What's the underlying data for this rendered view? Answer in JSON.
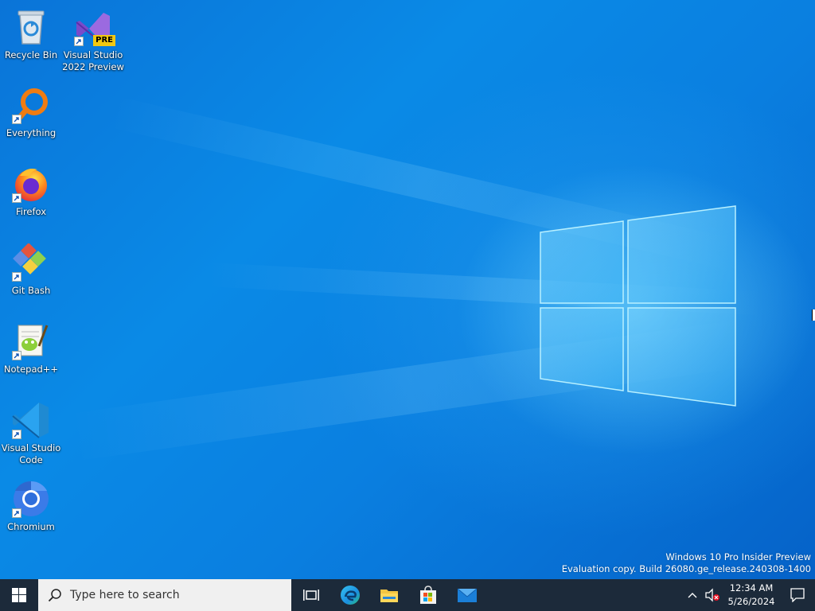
{
  "desktop": {
    "icons": [
      {
        "label": "Recycle Bin",
        "icon": "recycle-bin-icon"
      },
      {
        "label": "Visual Studio 2022 Preview",
        "icon": "visual-studio-preview-icon",
        "badge": "PRE"
      },
      {
        "label": "Everything",
        "icon": "everything-search-icon"
      },
      {
        "label": "Firefox",
        "icon": "firefox-icon"
      },
      {
        "label": "Git Bash",
        "icon": "git-bash-icon"
      },
      {
        "label": "Notepad++",
        "icon": "notepad-plus-plus-icon"
      },
      {
        "label": "Visual Studio Code",
        "icon": "vscode-icon"
      },
      {
        "label": "Chromium",
        "icon": "chromium-icon"
      }
    ],
    "watermark": {
      "line1": "Windows 10 Pro Insider Preview",
      "line2": "Evaluation copy. Build 26080.ge_release.240308-1400"
    }
  },
  "taskbar": {
    "search_placeholder": "Type here to search",
    "pinned": [
      "task-view-icon",
      "edge-icon",
      "file-explorer-icon",
      "microsoft-store-icon",
      "mail-icon"
    ],
    "clock": {
      "time": "12:34 AM",
      "date": "5/26/2024"
    }
  },
  "colors": {
    "taskbar": "#1c2a3a",
    "desktop_blue": "#0a7fe0",
    "search_bg": "#f0f0f0"
  }
}
